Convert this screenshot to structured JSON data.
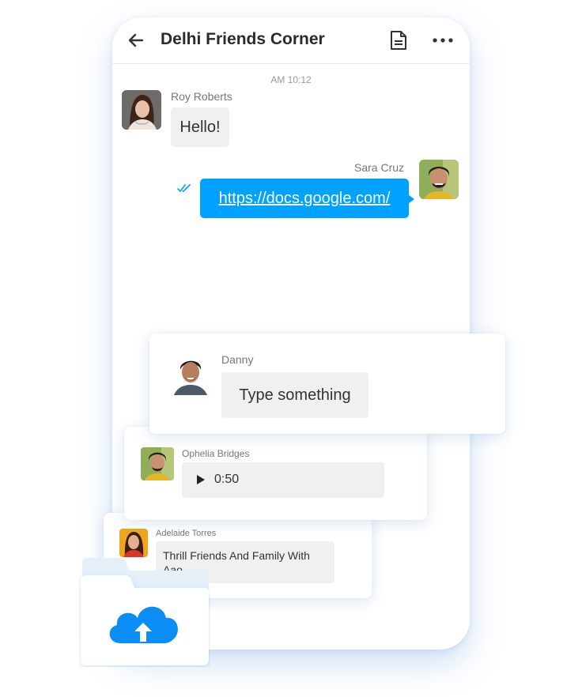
{
  "header": {
    "title": "Delhi Friends Corner",
    "back_icon": "arrow-left-icon",
    "doc_icon": "document-icon",
    "more_icon": "more-dots-icon"
  },
  "chat": {
    "timestamp": "AM 10:12",
    "messages": [
      {
        "sender": "Roy Roberts",
        "text": "Hello!"
      },
      {
        "sender": "Sara Cruz",
        "text": "https://docs.google.com/",
        "status_icon": "double-check-icon"
      }
    ]
  },
  "cards": [
    {
      "sender": "Danny",
      "text": "Type something"
    },
    {
      "sender": "Ophelia Bridges",
      "voice_duration": "0:50",
      "play_icon": "play-icon"
    },
    {
      "sender": "Adelaide Torres",
      "text": "Thrill Friends And Family With Aao."
    }
  ],
  "upload": {
    "icon": "cloud-upload-icon"
  },
  "colors": {
    "accent": "#00a2ff",
    "bubble": "#f0f0f0",
    "shadow": "#78aae6"
  }
}
